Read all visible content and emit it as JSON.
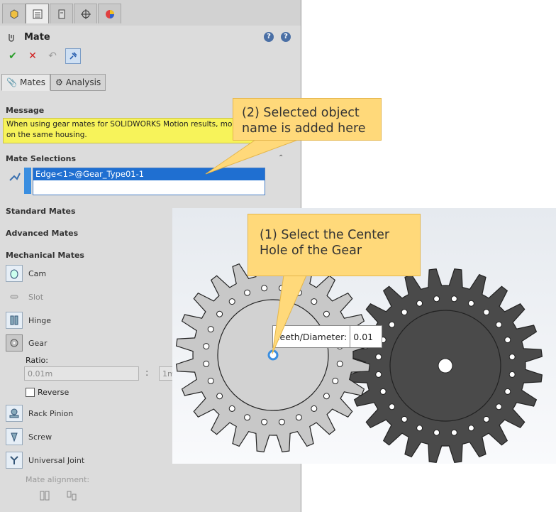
{
  "panel": {
    "title": "Mate",
    "subtabs": [
      "Mates",
      "Analysis"
    ],
    "sections": {
      "message": "Message",
      "mate_selections": "Mate Selections",
      "standard_mates": "Standard Mates",
      "advanced_mates": "Advanced Mates",
      "mechanical_mates": "Mechanical Mates"
    },
    "message_text": "When using gear mates for SOLIDWORKS Motion results, mount gears on the same housing.",
    "selection": "Edge<1>@Gear_Type01-1",
    "mechanical": [
      {
        "label": "Cam",
        "disabled": false
      },
      {
        "label": "Slot",
        "disabled": true
      },
      {
        "label": "Hinge",
        "disabled": false
      },
      {
        "label": "Gear",
        "disabled": false
      },
      {
        "label": "Rack Pinion",
        "disabled": false
      },
      {
        "label": "Screw",
        "disabled": false
      },
      {
        "label": "Universal Joint",
        "disabled": false
      }
    ],
    "ratio_label": "Ratio:",
    "ratio_value": "0.01m",
    "ratio_value2": "1m",
    "ratio_colon": ":",
    "reverse_label": "Reverse",
    "alignment_label": "Mate alignment:"
  },
  "canvas": {
    "teeth_label": "Teeth/Diameter:",
    "teeth_value": "0.01"
  },
  "callouts": {
    "selected_name_line1": "(2) Selected object",
    "selected_name_line2": "name is added here",
    "select_hole_line1": "(1) Select the Center",
    "select_hole_line2": "Hole of the Gear"
  },
  "colors": {
    "callout": "#ffd97a",
    "message": "#f7f35a",
    "selection": "#1f6fd1",
    "gear_light": "#c8c8c8",
    "gear_dark": "#4a4a4a"
  }
}
